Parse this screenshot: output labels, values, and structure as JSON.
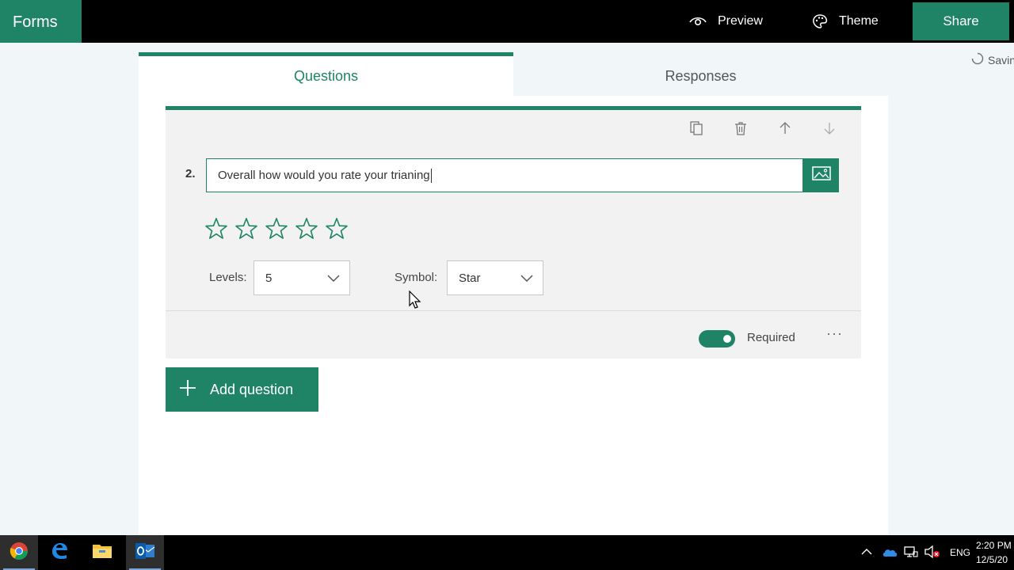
{
  "app": {
    "brand": "Forms"
  },
  "header": {
    "preview_label": "Preview",
    "theme_label": "Theme",
    "share_label": "Share",
    "saving_status": "Saving"
  },
  "tabs": [
    {
      "label": "Questions",
      "active": true
    },
    {
      "label": "Responses",
      "active": false
    }
  ],
  "question": {
    "number": "2.",
    "text": "Overall how would you rate your trianing",
    "rating_symbols": 5,
    "levels_label": "Levels:",
    "levels_value": "5",
    "symbol_label": "Symbol:",
    "symbol_value": "Star",
    "required_label": "Required",
    "required_on": true,
    "more_label": "···"
  },
  "add_question_label": "Add question",
  "taskbar": {
    "apps": [
      "chrome-icon",
      "edge-icon",
      "file-explorer-icon",
      "outlook-icon"
    ],
    "language": "ENG",
    "time": "2:20 PM",
    "date": "12/5/20"
  },
  "colors": {
    "accent": "#1f8466",
    "panel": "#f2f2f2",
    "background": "#f1f7f8"
  }
}
